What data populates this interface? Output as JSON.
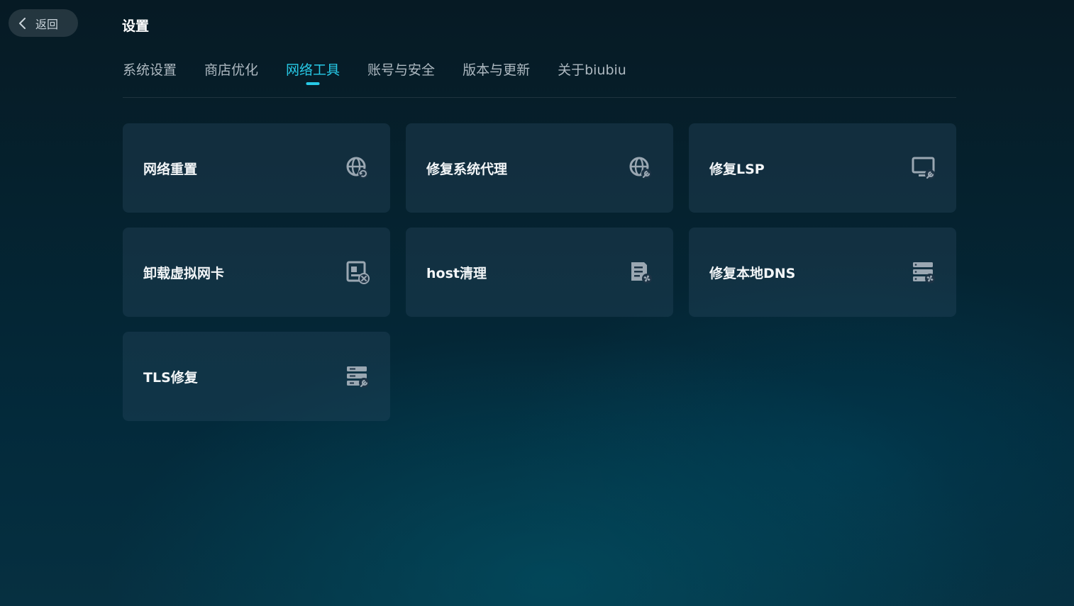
{
  "back": {
    "label": "返回",
    "icon": "chevron-left-icon"
  },
  "page": {
    "title": "设置"
  },
  "tabs": [
    {
      "label": "系统设置",
      "active": false
    },
    {
      "label": "商店优化",
      "active": false
    },
    {
      "label": "网络工具",
      "active": true
    },
    {
      "label": "账号与安全",
      "active": false
    },
    {
      "label": "版本与更新",
      "active": false
    },
    {
      "label": "关于biubiu",
      "active": false
    }
  ],
  "tools": [
    {
      "label": "网络重置",
      "icon": "globe-refresh-icon"
    },
    {
      "label": "修复系统代理",
      "icon": "globe-wrench-icon"
    },
    {
      "label": "修复LSP",
      "icon": "monitor-wrench-icon"
    },
    {
      "label": "卸载虚拟网卡",
      "icon": "network-card-remove-icon"
    },
    {
      "label": "host清理",
      "icon": "document-fan-icon"
    },
    {
      "label": "修复本地DNS",
      "icon": "server-fan-icon"
    },
    {
      "label": "TLS修复",
      "icon": "server-wrench-icon"
    }
  ],
  "colors": {
    "accent": "#27c9e6",
    "icon": "#9aa7b2"
  }
}
